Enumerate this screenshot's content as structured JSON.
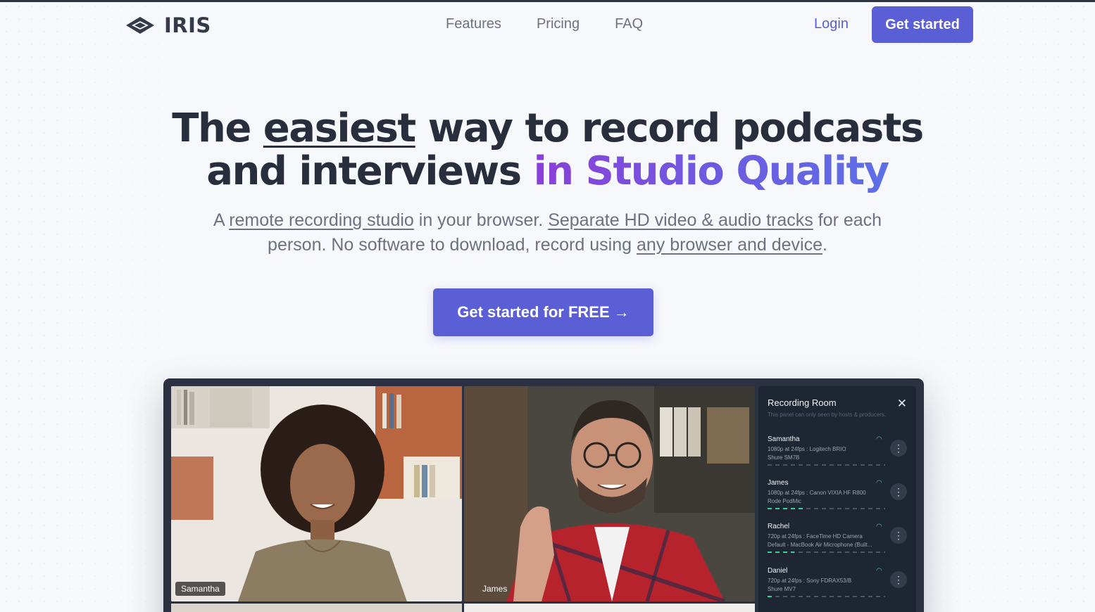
{
  "brand": {
    "name": "IRIS"
  },
  "nav": {
    "links": [
      "Features",
      "Pricing",
      "FAQ"
    ],
    "login": "Login",
    "cta": "Get started"
  },
  "hero": {
    "title_part1": "The ",
    "title_underlined": "easiest",
    "title_part2": " way to record podcasts",
    "title_line2": "and interviews ",
    "title_gradient": "in Studio Quality",
    "sub_prefix": "A ",
    "sub_link1": "remote recording studio",
    "sub_mid1": " in your browser. ",
    "sub_link2": "Separate HD video & audio tracks",
    "sub_mid2": " for each person. No software to download, record using ",
    "sub_link3": "any browser and device",
    "sub_suffix": ".",
    "cta": "Get started for FREE →"
  },
  "demo": {
    "tiles": [
      {
        "name": "Samantha"
      },
      {
        "name": "James"
      }
    ],
    "panel": {
      "title": "Recording Room",
      "close_icon": "close-icon",
      "note": "This panel can only seen by hosts & producers.",
      "participants": [
        {
          "name": "Samantha",
          "line1": "1080p at 24fps : Logitech BRIO",
          "line2": "Shure SM7B",
          "level": 0.0
        },
        {
          "name": "James",
          "line1": "1080p at 24fps : Canon VIXIA HF R800",
          "line2": "Rode PodMic",
          "level": 0.3
        },
        {
          "name": "Rachel",
          "line1": "720p at 24fps : FaceTime HD Camera",
          "line2": "Default - MacBook Air Microphone (Built...",
          "level": 0.23
        },
        {
          "name": "Daniel",
          "line1": "720p at 24fps : Sony FDRAX53/B",
          "line2": "Shure MV7",
          "level": 0.05
        }
      ]
    }
  },
  "colors": {
    "accent": "#5b5fd6",
    "text": "#282e3b",
    "muted": "#6b7280",
    "signal": "#34d399"
  }
}
